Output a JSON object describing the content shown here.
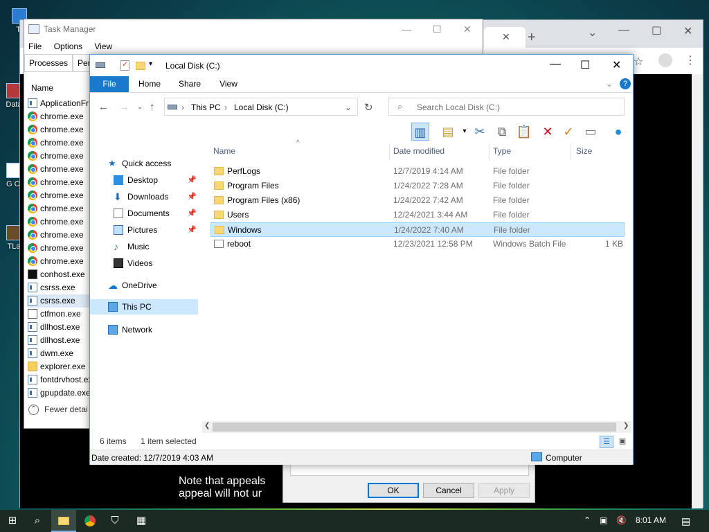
{
  "desktop": {
    "icons": [
      {
        "label": "Tl",
        "name": "desktop-icon-1"
      },
      {
        "label": "Data",
        "name": "desktop-icon-2"
      },
      {
        "label": "G Cl",
        "name": "desktop-icon-3"
      },
      {
        "label": "TLa",
        "name": "desktop-icon-4"
      }
    ]
  },
  "browser": {
    "note_line1": "Note that appeals",
    "note_line2": "appeal will not ur"
  },
  "taskmgr": {
    "title": "Task Manager",
    "menu": [
      "File",
      "Options",
      "View"
    ],
    "tabs": [
      "Processes",
      "Perfo"
    ],
    "column_header": "Name",
    "processes": [
      {
        "name": "ApplicationFr",
        "icon": "app"
      },
      {
        "name": "chrome.exe",
        "icon": "chrome"
      },
      {
        "name": "chrome.exe",
        "icon": "chrome"
      },
      {
        "name": "chrome.exe",
        "icon": "chrome"
      },
      {
        "name": "chrome.exe",
        "icon": "chrome"
      },
      {
        "name": "chrome.exe",
        "icon": "chrome"
      },
      {
        "name": "chrome.exe",
        "icon": "chrome"
      },
      {
        "name": "chrome.exe",
        "icon": "chrome"
      },
      {
        "name": "chrome.exe",
        "icon": "chrome"
      },
      {
        "name": "chrome.exe",
        "icon": "chrome"
      },
      {
        "name": "chrome.exe",
        "icon": "chrome"
      },
      {
        "name": "chrome.exe",
        "icon": "chrome"
      },
      {
        "name": "chrome.exe",
        "icon": "chrome"
      },
      {
        "name": "conhost.exe",
        "icon": "con"
      },
      {
        "name": "csrss.exe",
        "icon": "app"
      },
      {
        "name": "csrss.exe",
        "icon": "app",
        "selected": true
      },
      {
        "name": "ctfmon.exe",
        "icon": "pen"
      },
      {
        "name": "dllhost.exe",
        "icon": "app"
      },
      {
        "name": "dllhost.exe",
        "icon": "app"
      },
      {
        "name": "dwm.exe",
        "icon": "app"
      },
      {
        "name": "explorer.exe",
        "icon": "fold"
      },
      {
        "name": "fontdrvhost.ex",
        "icon": "app"
      },
      {
        "name": "gpupdate.exe",
        "icon": "app"
      }
    ],
    "fewer_details": "Fewer detai"
  },
  "properties_dialog": {
    "ok": "OK",
    "cancel": "Cancel",
    "apply": "Apply"
  },
  "explorer": {
    "title": "Local Disk (C:)",
    "ribbon_tabs": [
      "File",
      "Home",
      "Share",
      "View"
    ],
    "address": {
      "root": "This PC",
      "current": "Local Disk (C:)"
    },
    "search_placeholder": "Search Local Disk (C:)",
    "nav": {
      "quick_access": "Quick access",
      "desktop": "Desktop",
      "downloads": "Downloads",
      "documents": "Documents",
      "pictures": "Pictures",
      "music": "Music",
      "videos": "Videos",
      "onedrive": "OneDrive",
      "this_pc": "This PC",
      "network": "Network"
    },
    "columns": {
      "name": "Name",
      "date": "Date modified",
      "type": "Type",
      "size": "Size"
    },
    "files": [
      {
        "name": "PerfLogs",
        "date": "12/7/2019 4:14 AM",
        "type": "File folder",
        "size": "",
        "icon": "folder"
      },
      {
        "name": "Program Files",
        "date": "1/24/2022 7:28 AM",
        "type": "File folder",
        "size": "",
        "icon": "folder"
      },
      {
        "name": "Program Files (x86)",
        "date": "1/24/2022 7:42 AM",
        "type": "File folder",
        "size": "",
        "icon": "folder"
      },
      {
        "name": "Users",
        "date": "12/24/2021 3:44 AM",
        "type": "File folder",
        "size": "",
        "icon": "folder"
      },
      {
        "name": "Windows",
        "date": "1/24/2022 7:40 AM",
        "type": "File folder",
        "size": "",
        "icon": "folder",
        "selected": true
      },
      {
        "name": "reboot",
        "date": "12/23/2021 12:58 PM",
        "type": "Windows Batch File",
        "size": "1 KB",
        "icon": "bat"
      }
    ],
    "status": {
      "count": "6 items",
      "selected": "1 item selected"
    },
    "detail": {
      "date_created": "Date created: 12/7/2019 4:03 AM",
      "location": "Computer"
    }
  },
  "taskbar": {
    "time": "8:01 AM"
  }
}
